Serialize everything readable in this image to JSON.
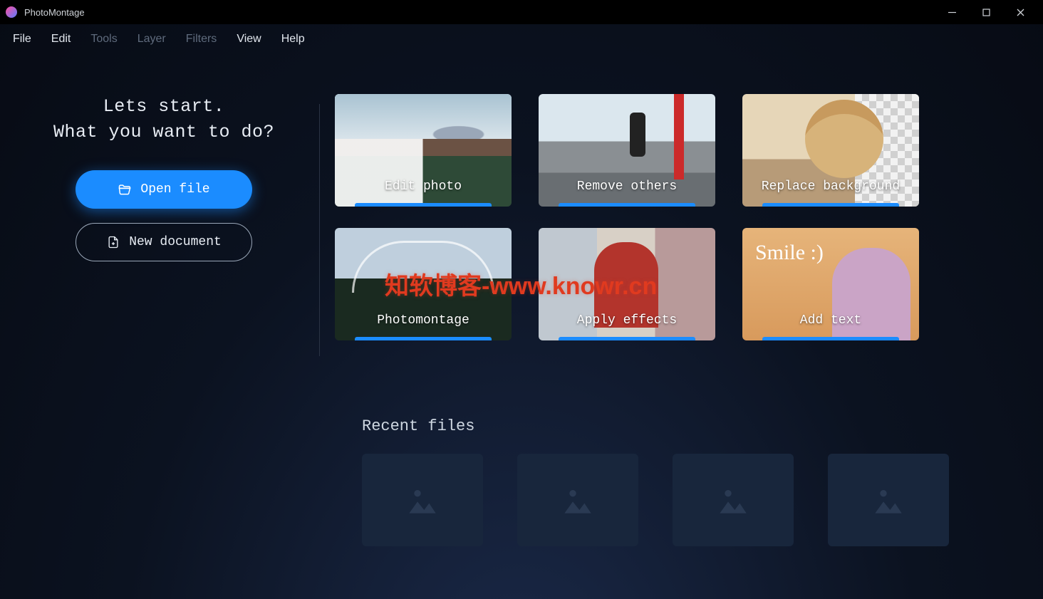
{
  "app": {
    "title": "PhotoMontage"
  },
  "menu": {
    "items": [
      {
        "label": "File",
        "enabled": true
      },
      {
        "label": "Edit",
        "enabled": true
      },
      {
        "label": "Tools",
        "enabled": false
      },
      {
        "label": "Layer",
        "enabled": false
      },
      {
        "label": "Filters",
        "enabled": false
      },
      {
        "label": "View",
        "enabled": true
      },
      {
        "label": "Help",
        "enabled": true
      }
    ]
  },
  "start": {
    "heading_line1": "Lets start.",
    "heading_line2": "What you want to do?",
    "open_file": "Open file",
    "new_document": "New document"
  },
  "cards": [
    {
      "label": "Edit photo"
    },
    {
      "label": "Remove others"
    },
    {
      "label": "Replace background"
    },
    {
      "label": "Photomontage"
    },
    {
      "label": "Apply effects"
    },
    {
      "label": "Add text",
      "overlay_text": "Smile :)"
    }
  ],
  "recent": {
    "title": "Recent files",
    "placeholders": 4
  },
  "watermark": "知软博客-www.knowr.cn"
}
